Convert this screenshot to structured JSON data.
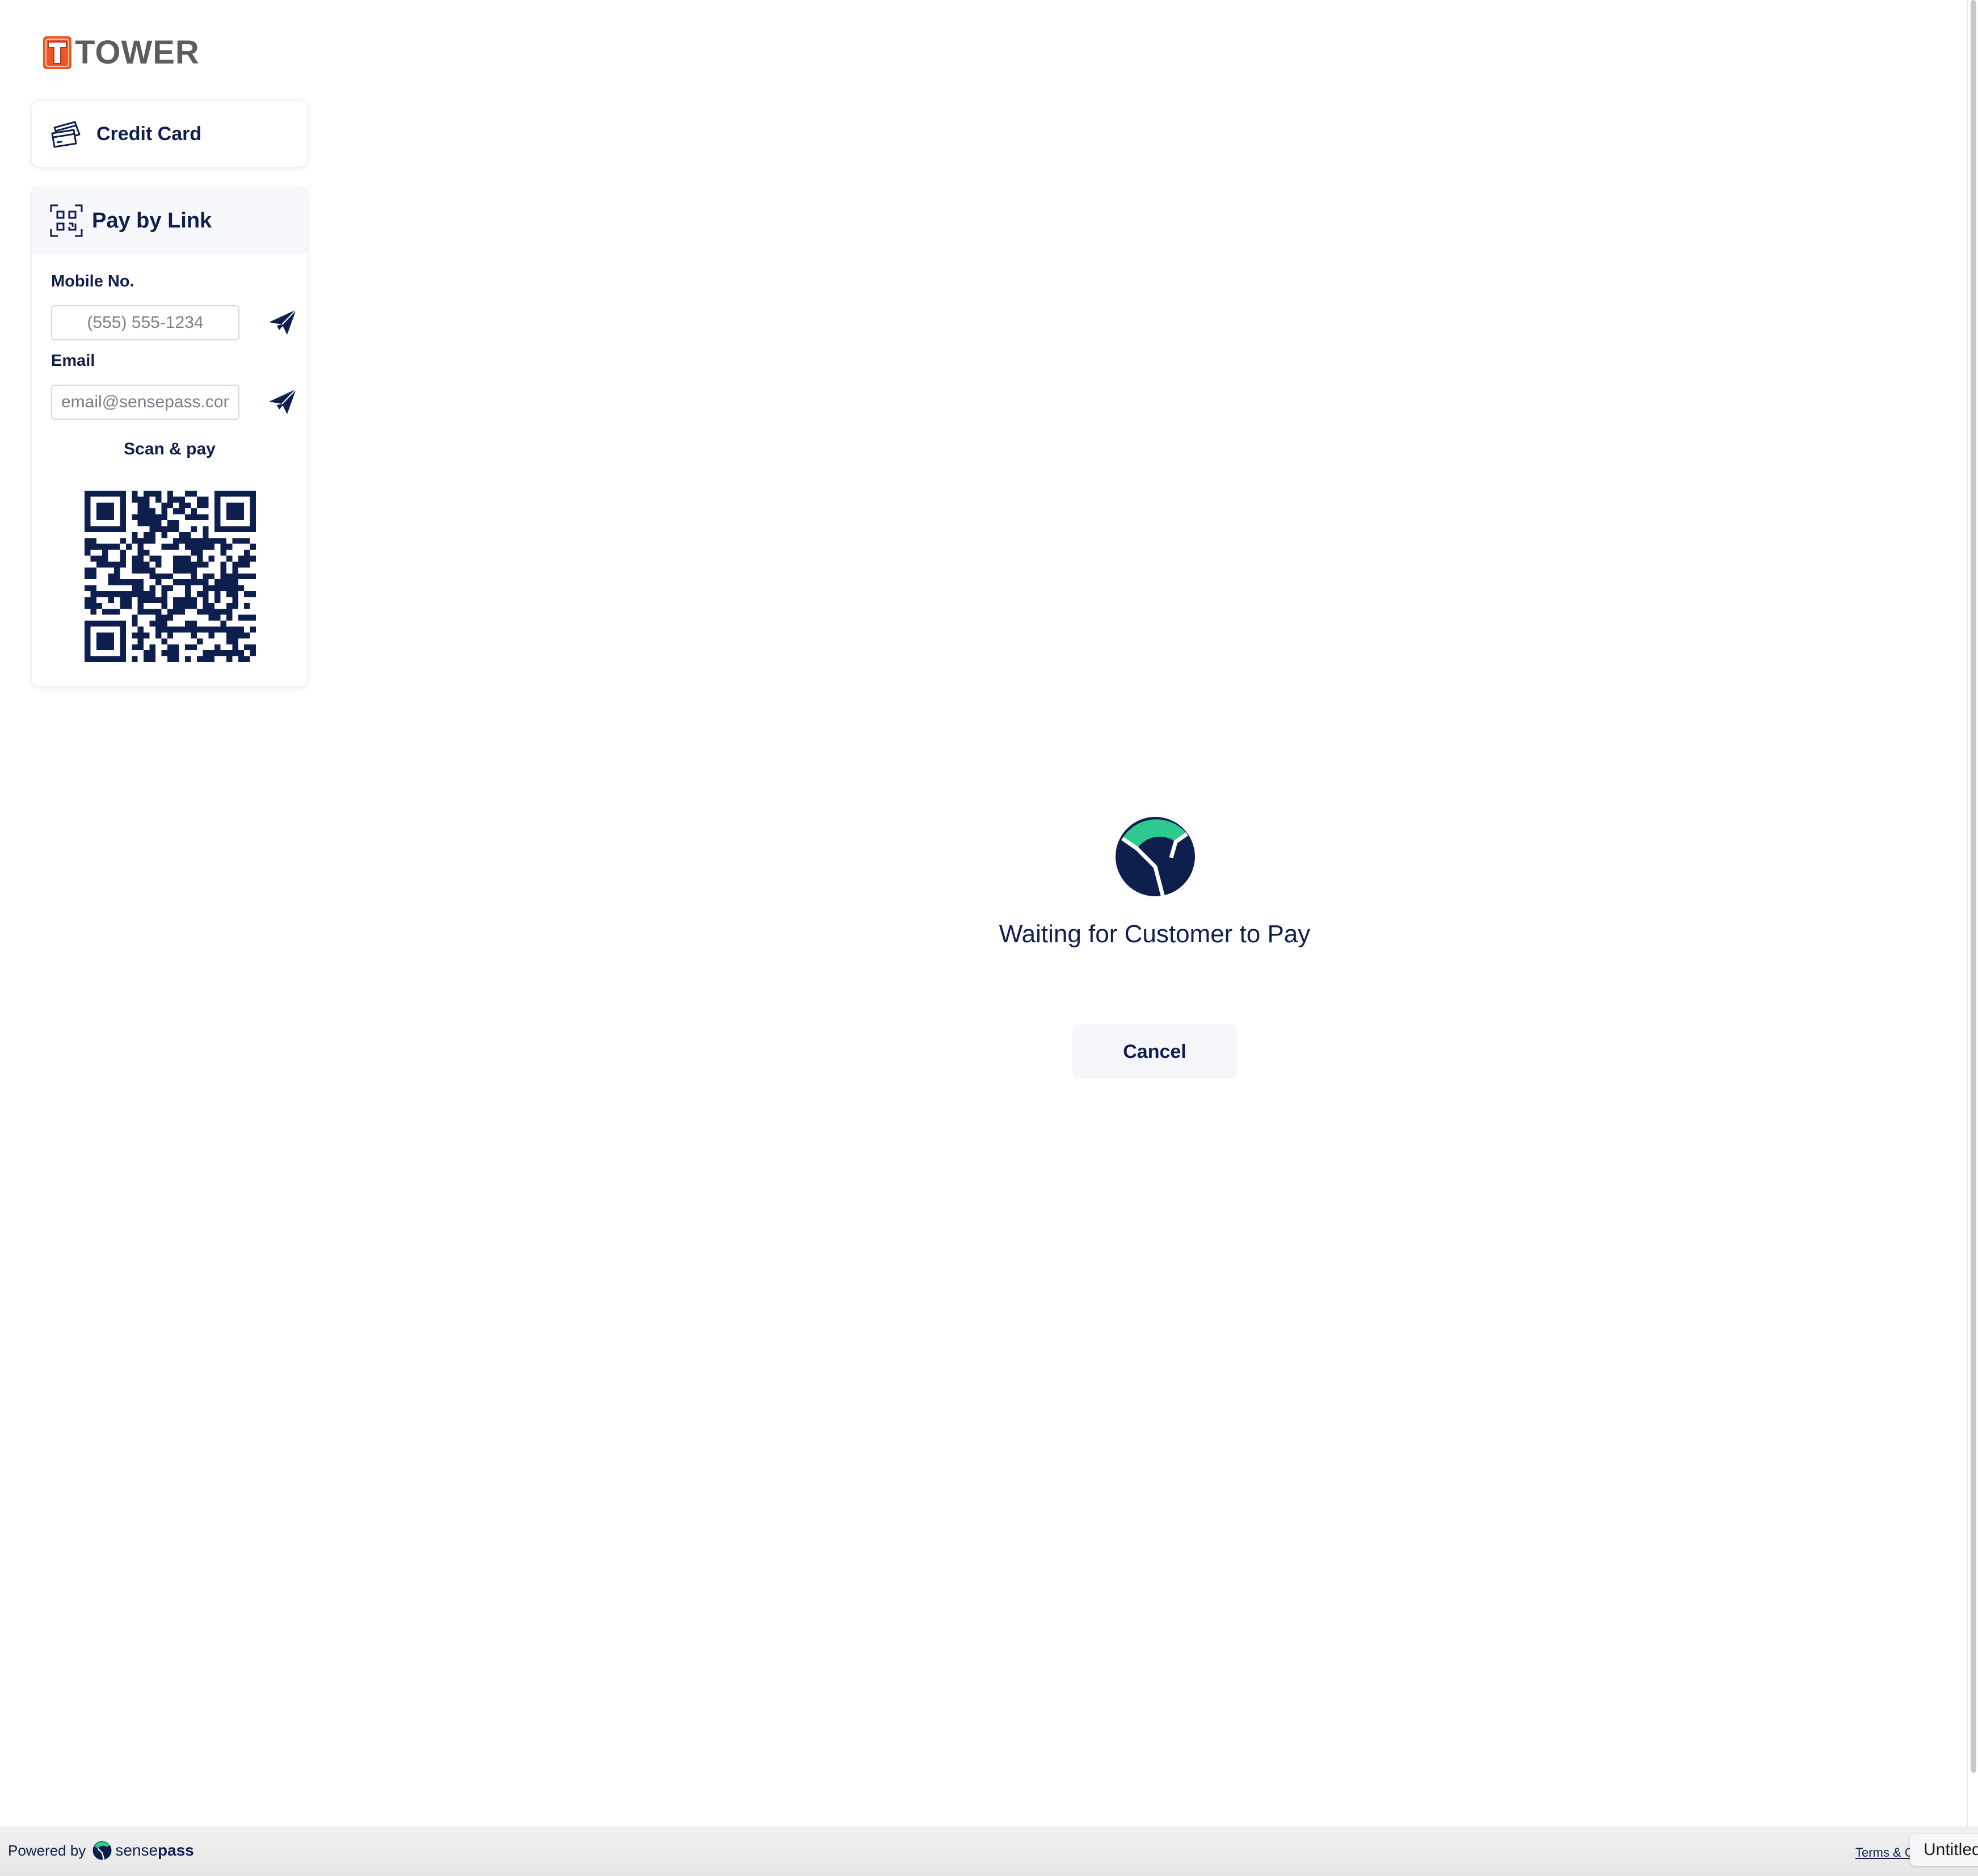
{
  "brand": {
    "logo_letter": "T",
    "logo_text": "TOWER"
  },
  "payment_methods": {
    "credit_card": {
      "label": "Credit Card",
      "icon": "credit-card-icon"
    },
    "pay_by_link": {
      "label": "Pay by Link",
      "icon": "qr-scan-icon",
      "mobile_label": "Mobile No.",
      "mobile_placeholder": "(555) 555-1234",
      "email_label": "Email",
      "email_placeholder": "email@sensepass.com",
      "send_icon": "paper-plane-icon",
      "scan_label": "Scan & pay",
      "qr_icon": "qr-code"
    }
  },
  "status": {
    "message": "Waiting for Customer to Pay",
    "icon": "sensepass-logo-icon",
    "cancel_label": "Cancel"
  },
  "footer": {
    "powered_by": "Powered by",
    "brand_regular": "sense",
    "brand_bold": "pass",
    "terms_label": "Terms & Conditions",
    "tab_label": "Untitled"
  },
  "colors": {
    "navy": "#0f1f4d",
    "green": "#2ec98e",
    "logo_orange": "#e8562a",
    "logo_gray": "#5b5d61"
  }
}
